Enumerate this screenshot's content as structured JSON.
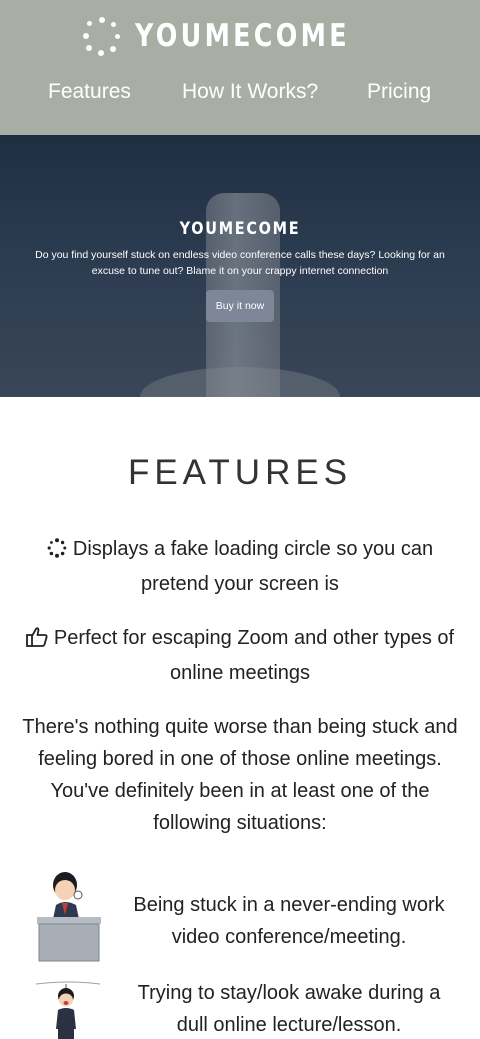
{
  "header": {
    "logo_text": "YOUMECOME",
    "nav": [
      {
        "label": "Features"
      },
      {
        "label": "How It Works?"
      },
      {
        "label": "Pricing"
      }
    ],
    "background_color": "#a9aea5"
  },
  "hero": {
    "title": "YOUMECOME",
    "description": "Do you find yourself stuck on endless video conference calls these days? Looking for an excuse to tune out? Blame it on your crappy internet connection",
    "button_label": "Buy it now"
  },
  "features": {
    "title": "FEATURES",
    "items": [
      {
        "icon": "spinner-icon",
        "text": "Displays a fake loading circle so you can pretend your screen is"
      },
      {
        "icon": "thumbs-up-icon",
        "text": "Perfect for escaping Zoom and other types of online meetings"
      }
    ],
    "intro": "There's nothing quite worse than being stuck and feeling bored in one of those online meetings. You've definitely been in at least one of the following situations:",
    "situations": [
      {
        "icon": "bored-office-worker-illustration",
        "text": "Being stuck in a never-ending work video conference/meeting."
      },
      {
        "icon": "sleepy-student-illustration",
        "text": "Trying to stay/look awake during a dull online lecture/lesson."
      }
    ]
  }
}
